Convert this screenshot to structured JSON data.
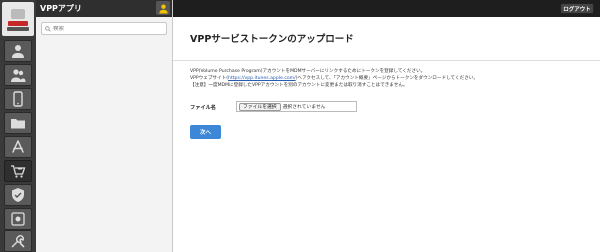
{
  "sidebar": {
    "title": "VPPアプリ",
    "search_placeholder": "検索",
    "icons": [
      "user-icon",
      "users-icon",
      "mobile-device-icon",
      "folder-icon",
      "app-store-icon",
      "vpp-cart-icon",
      "shield-icon",
      "scan-icon",
      "tools-icon"
    ],
    "active_index": 5
  },
  "topbar": {
    "logout_label": "ログアウト"
  },
  "main": {
    "title": "VPPサービストークンのアップロード",
    "line1": "VPP(Volume Purchase Program)アカウントをMDMサーバーにリンクするためにトークンを登録してください。",
    "line2_pre": "VPPウェブサイト(",
    "line2_link": "https://vpp.itunes.apple.com/",
    "line2_post": ")へアクセスして、「アカウント概要」ページからトークンをダウンロードしてください。",
    "line3": "【注意】一度MDMに登録したVPPアカウントを別のアカウントに変更または取り消すことはできません。",
    "file_label": "ファイル名",
    "file_button": "ファイルを選択",
    "file_status": "選択されていません",
    "next_label": "次へ"
  },
  "colors": {
    "accent": "#3d87d8",
    "rail": "#3a3a3a",
    "topbar": "#1e1e1e"
  }
}
